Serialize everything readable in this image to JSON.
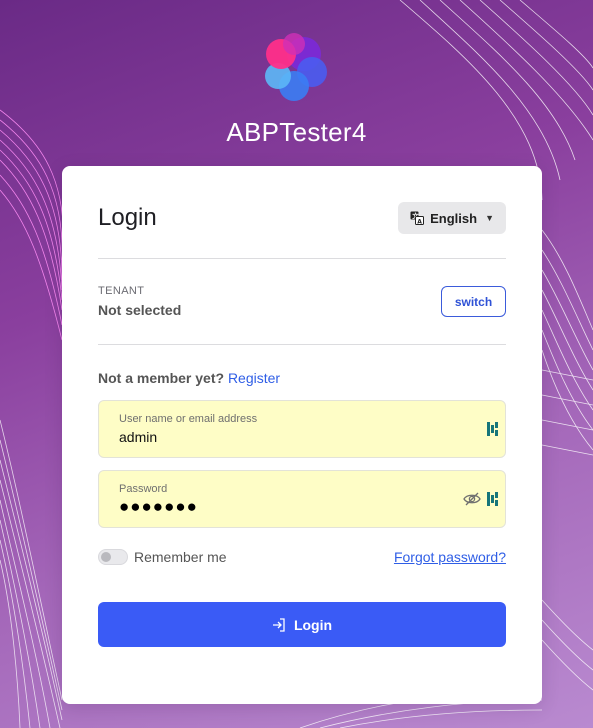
{
  "brand": {
    "app_name": "ABPTester4",
    "logo_icon": "abp-logo-icon"
  },
  "colors": {
    "accent": "#3a5bf6",
    "link": "#2f5ee6",
    "autofill": "#fefdc6"
  },
  "card": {
    "title": "Login",
    "language": {
      "label": "English",
      "icon": "translate-icon"
    }
  },
  "tenant": {
    "label": "TENANT",
    "value": "Not selected",
    "switch_label": "switch"
  },
  "register": {
    "prompt": "Not a member yet?",
    "link": "Register"
  },
  "fields": {
    "username": {
      "label": "User name or email address",
      "value": "admin"
    },
    "password": {
      "label": "Password",
      "masked": "●●●●●●●"
    }
  },
  "remember": {
    "label": "Remember me",
    "checked": false
  },
  "forgot": {
    "label": "Forgot password?"
  },
  "submit": {
    "label": "Login",
    "icon": "login-icon"
  }
}
